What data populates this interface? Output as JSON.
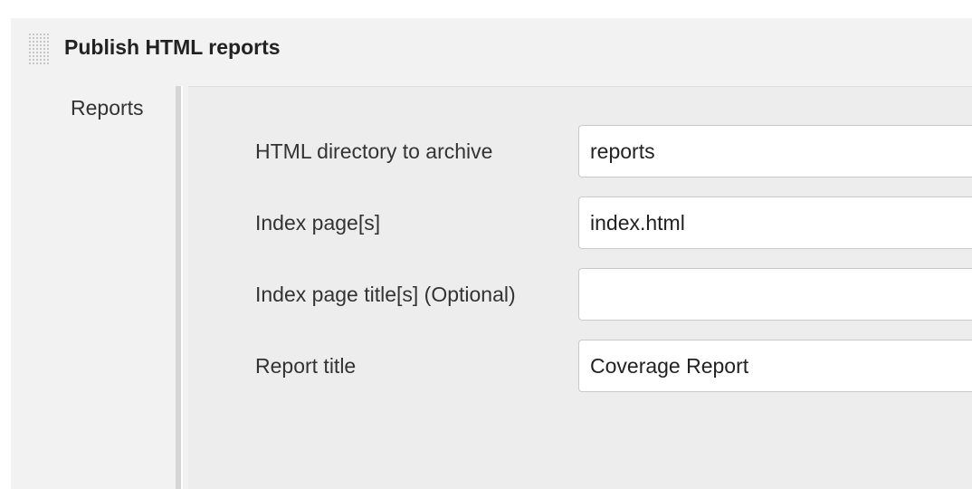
{
  "section": {
    "title": "Publish HTML reports"
  },
  "reports": {
    "label": "Reports",
    "fields": [
      {
        "label": "HTML directory to archive",
        "value": "reports"
      },
      {
        "label": "Index page[s]",
        "value": "index.html"
      },
      {
        "label": "Index page title[s] (Optional)",
        "value": ""
      },
      {
        "label": "Report title",
        "value": "Coverage Report"
      }
    ]
  }
}
